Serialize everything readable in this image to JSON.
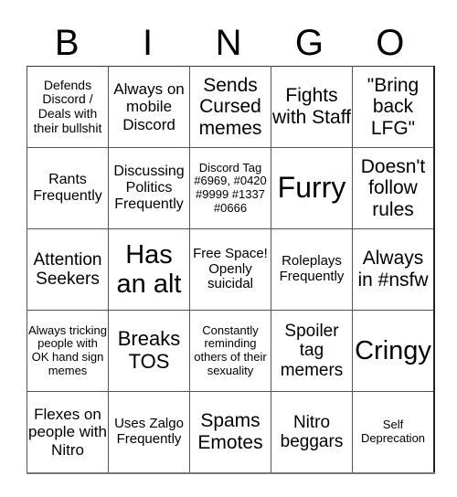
{
  "header": {
    "letters": [
      "B",
      "I",
      "N",
      "G",
      "O"
    ]
  },
  "card": {
    "rows": [
      [
        "Defends Discord / Deals with their bullshit",
        "Always on mobile Discord",
        "Sends Cursed memes",
        "Fights with Staff",
        "\"Bring back LFG\""
      ],
      [
        "Rants Frequently",
        "Discussing Politics Frequently",
        "Discord Tag #6969, #0420 #9999 #1337 #0666",
        "Furry",
        "Doesn't follow rules"
      ],
      [
        "Attention Seekers",
        "Has an alt",
        "Free Space! Openly suicidal",
        "Roleplays Frequently",
        "Always in #nsfw"
      ],
      [
        "Always tricking people with OK hand sign memes",
        "Breaks TOS",
        "Constantly reminding others of their sexuality",
        "Spoiler tag memers",
        "Cringy"
      ],
      [
        "Flexes on people with Nitro",
        "Uses Zalgo Frequently",
        "Spams Emotes",
        "Nitro beggars",
        "Self Deprecation"
      ]
    ],
    "free_space": {
      "row": 2,
      "col": 2
    }
  }
}
